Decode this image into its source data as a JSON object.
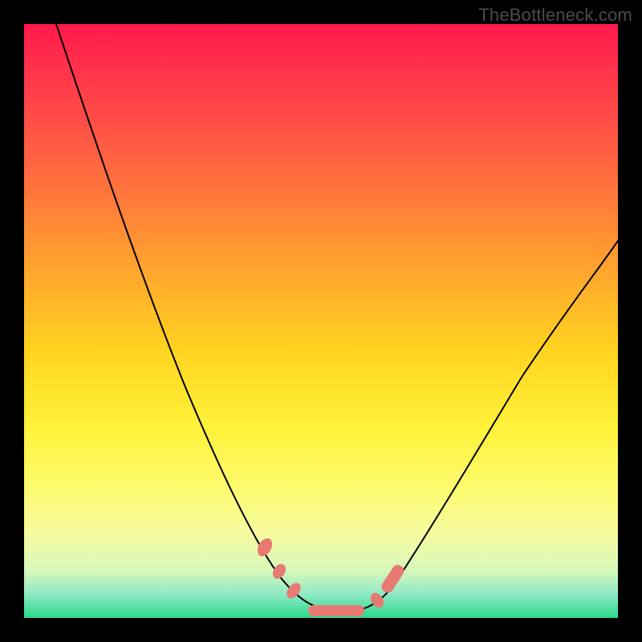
{
  "attribution": "TheBottleneck.com",
  "colors": {
    "frame": "#000000",
    "gradient_top": "#ff1a4d",
    "gradient_bottom": "#29d98c",
    "curve": "#000000",
    "marker": "#e77b73"
  },
  "chart_data": {
    "type": "line",
    "title": "",
    "xlabel": "",
    "ylabel": "",
    "xlim": [
      0,
      100
    ],
    "ylim": [
      0,
      100
    ],
    "grid": false,
    "legend": false,
    "annotations": [],
    "series": [
      {
        "name": "bottleneck-curve",
        "x": [
          0,
          5,
          10,
          15,
          20,
          25,
          30,
          35,
          40,
          43,
          46,
          49,
          52,
          55,
          58,
          61,
          64,
          70,
          76,
          82,
          88,
          94,
          100
        ],
        "values": [
          100,
          92,
          83,
          74,
          64,
          54,
          43,
          32,
          20,
          12,
          6,
          2,
          1,
          1,
          1,
          2,
          6,
          14,
          23,
          32,
          41,
          49,
          56
        ]
      }
    ],
    "markers": [
      {
        "x": 42.5,
        "y": 13,
        "shape": "oval"
      },
      {
        "x": 44.5,
        "y": 9,
        "shape": "oval"
      },
      {
        "x": 46.5,
        "y": 5,
        "shape": "oval"
      },
      {
        "x": 52.0,
        "y": 1,
        "shape": "bar"
      },
      {
        "x": 58.5,
        "y": 3,
        "shape": "oval"
      },
      {
        "x": 62.5,
        "y": 9,
        "shape": "bar"
      }
    ]
  }
}
